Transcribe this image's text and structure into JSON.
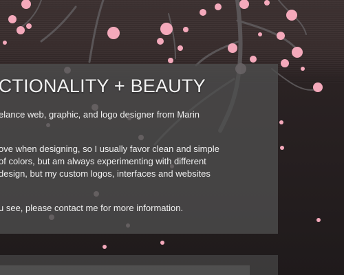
{
  "colors": {
    "background": "#2a2223",
    "panel": "#4e4e4e",
    "blossom": "#f2a6b8",
    "text": "#f0f0f0"
  },
  "intro": {
    "heading": "NCTIONALITY + BEAUTY",
    "line1": "elance web, graphic, and logo designer from Marin",
    "line2": "ove when designing, so I usually favor clean and simple",
    "line3": "of colors, but am always experimenting with different",
    "line4": "design, but my custom logos, interfaces and websites",
    "line5": "u see, please contact me for more information."
  },
  "decor": {
    "background_image": "cherry-blossom-branch"
  }
}
